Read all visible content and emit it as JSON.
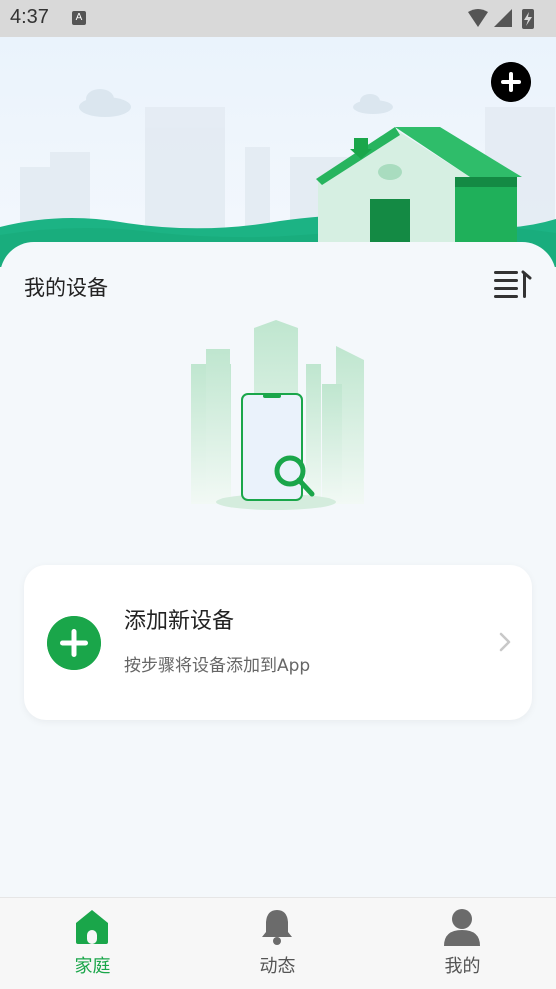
{
  "statusbar": {
    "time": "4:37",
    "notification_icon": "A"
  },
  "header": {
    "add_icon": "plus-circle-icon"
  },
  "devices": {
    "title": "我的设备",
    "sort_icon": "sort-list-icon",
    "add_card": {
      "title": "添加新设备",
      "subtitle": "按步骤将设备添加到App"
    }
  },
  "tabbar": {
    "tabs": [
      {
        "label": "家庭",
        "icon": "home-icon",
        "active": true
      },
      {
        "label": "动态",
        "icon": "bell-icon",
        "active": false
      },
      {
        "label": "我的",
        "icon": "person-icon",
        "active": false
      }
    ]
  },
  "colors": {
    "accent": "#1aa64a",
    "background": "#f4f8fb"
  }
}
